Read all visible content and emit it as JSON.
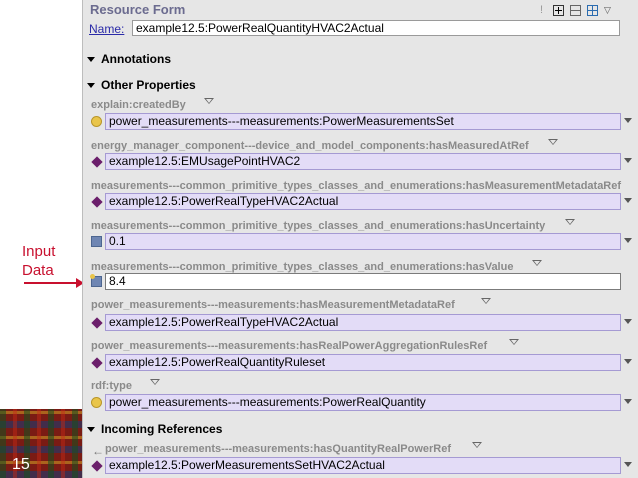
{
  "slide": {
    "annotation_line1": "Input",
    "annotation_line2": "Data",
    "slide_number": "15"
  },
  "form": {
    "title": "Resource Form",
    "name_label": "Name:",
    "name_value": "example12.5:PowerRealQuantityHVAC2Actual"
  },
  "sections": {
    "annotations": "Annotations",
    "other_properties": "Other Properties",
    "incoming_references": "Incoming References"
  },
  "properties": [
    {
      "label": "explain:createdBy",
      "value": "power_measurements---measurements:PowerMeasurementsSet",
      "icon": "class-circle-icon"
    },
    {
      "label": "energy_manager_component---device_and_model_components:hasMeasuredAtRef",
      "value": "example12.5:EMUsagePointHVAC2",
      "icon": "individual-diamond-icon"
    },
    {
      "label": "measurements---common_primitive_types_classes_and_enumerations:hasMeasurementMetadataRef",
      "value": "example12.5:PowerRealTypeHVAC2Actual",
      "icon": "individual-diamond-icon"
    },
    {
      "label": "measurements---common_primitive_types_classes_and_enumerations:hasUncertainty",
      "value": "0.1",
      "icon": "literal-square-icon"
    },
    {
      "label": "measurements---common_primitive_types_classes_and_enumerations:hasValue",
      "value": "8.4",
      "icon": "literal-tag-icon"
    },
    {
      "label": "power_measurements---measurements:hasMeasurementMetadataRef",
      "value": "example12.5:PowerRealTypeHVAC2Actual",
      "icon": "individual-diamond-icon"
    },
    {
      "label": "power_measurements---measurements:hasRealPowerAggregationRulesRef",
      "value": "example12.5:PowerRealQuantityRuleset",
      "icon": "individual-diamond-icon"
    },
    {
      "label": "rdf:type",
      "value": "power_measurements---measurements:PowerRealQuantity",
      "icon": "class-circle-icon"
    }
  ],
  "incoming": [
    {
      "label": "power_measurements---measurements:hasQuantityRealPowerRef",
      "value": "example12.5:PowerMeasurementsSetHVAC2Actual",
      "icon": "individual-diamond-icon"
    }
  ],
  "colors": {
    "value_box_bg": "#e3dcf7",
    "panel_bg": "#e6e6e6",
    "annotation_red": "#c8102e",
    "individual_purple": "#6b1f6b"
  }
}
